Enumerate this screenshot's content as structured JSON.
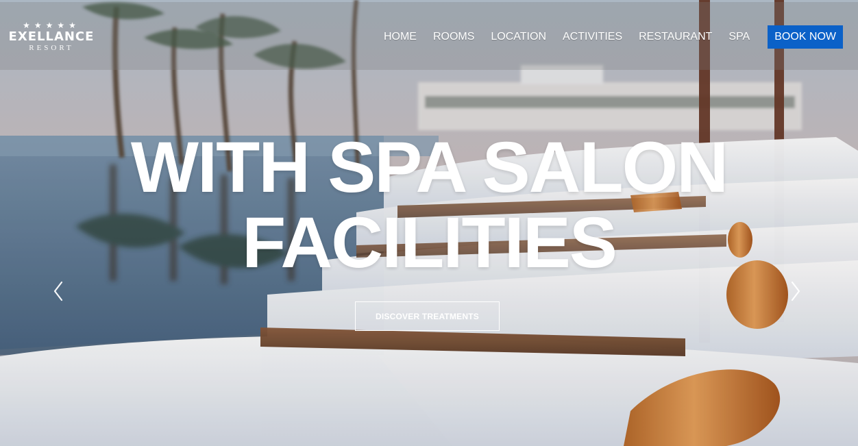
{
  "brand": {
    "stars": "★★★★★",
    "name": "EXELLANCE",
    "subtitle": "RESORT"
  },
  "nav": {
    "items": [
      "HOME",
      "ROOMS",
      "LOCATION",
      "ACTIVITIES",
      "RESTAURANT",
      "SPA"
    ],
    "book_label": "BOOK NOW",
    "book_color": "#0b61c8"
  },
  "hero": {
    "title_line1": "WITH SPA SALON",
    "title_line2": "FACILITIES",
    "cta_label": "DISCOVER TREATMENTS"
  },
  "carousel": {
    "prev_icon": "chevron-left-icon",
    "next_icon": "chevron-right-icon"
  }
}
